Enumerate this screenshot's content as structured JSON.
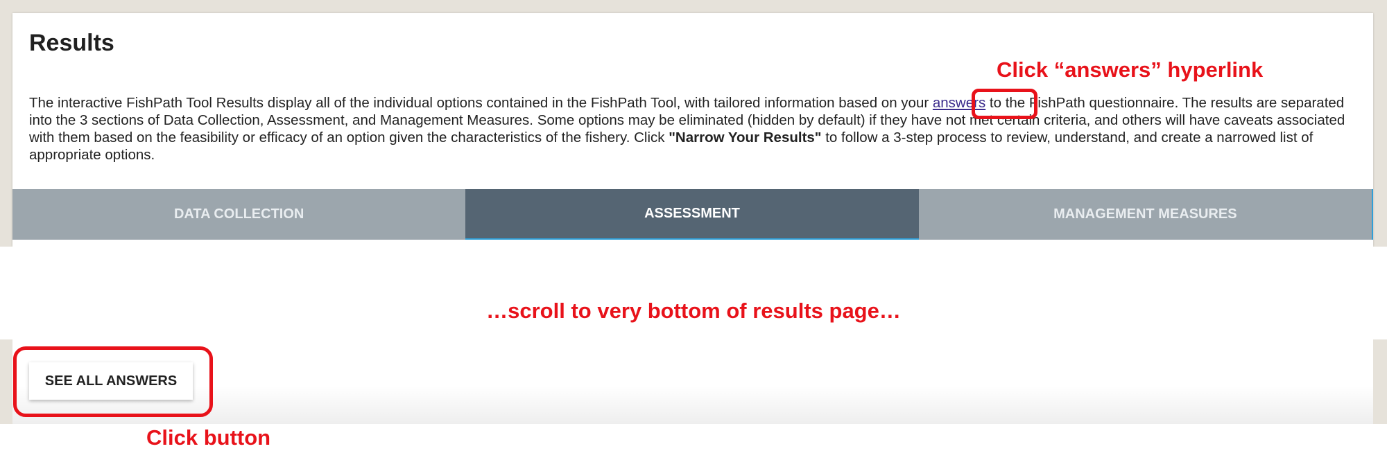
{
  "results": {
    "title": "Results",
    "intro": {
      "part1": "The interactive FishPath Tool Results display all of the individual options contained in the FishPath Tool, with tailored information based on your ",
      "link": "answers",
      "part2": " to the FishPath questionnaire. The results are separated into the 3 sections of Data Collection, Assessment, and Management Measures. Some options may be eliminated (hidden by default) if they have not met certain criteria, and others will have caveats associated with them based on the feasibility or efficacy of an option given the characteristics of the fishery. Click ",
      "bold": "\"Narrow Your Results\"",
      "part3": " to follow a 3-step process to review, understand, and create a narrowed list of appropriate options."
    },
    "tabs": [
      {
        "label": "DATA COLLECTION"
      },
      {
        "label": "ASSESSMENT"
      },
      {
        "label": "MANAGEMENT MEASURES"
      }
    ]
  },
  "bottom": {
    "see_all_label": "SEE ALL ANSWERS"
  },
  "annotations": {
    "link_label": "Click “answers” hyperlink",
    "scroll_note": "…scroll to very bottom of results page…",
    "button_label": "Click button",
    "color": "#e8121a"
  },
  "colors": {
    "tab_inactive": "#9ca6ad",
    "tab_active": "#556573",
    "page_background": "#e6e2da",
    "link": "#3b2b8c"
  }
}
